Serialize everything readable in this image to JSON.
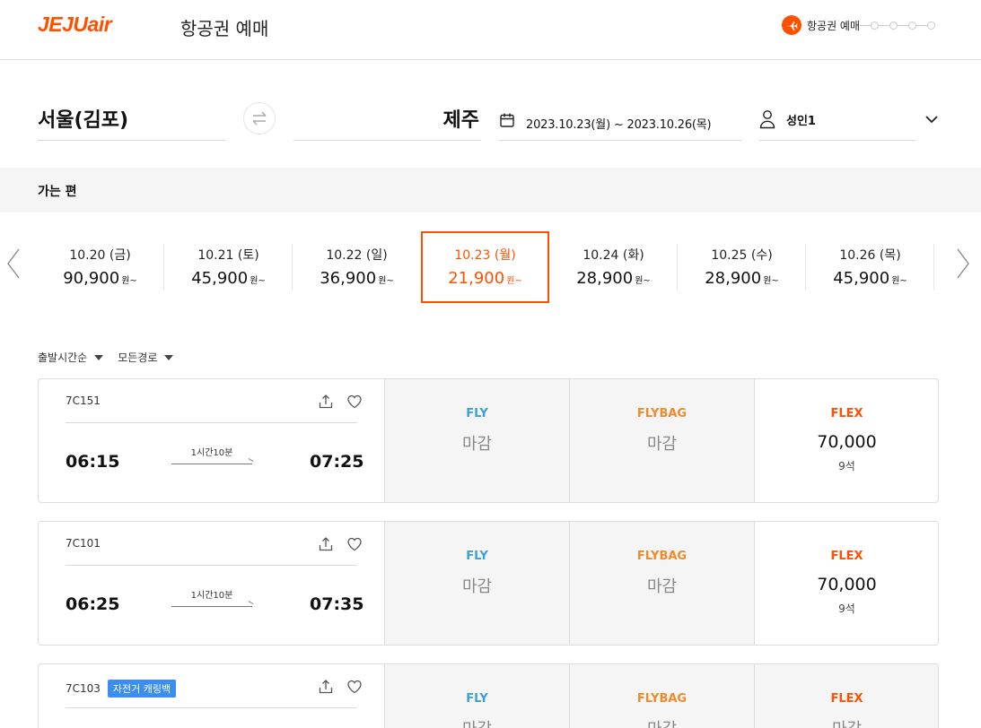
{
  "header": {
    "logo": "JEJUair",
    "title": "항공권 예매",
    "step_label": "항공권 예매"
  },
  "search": {
    "origin": "서울(김포)",
    "destination": "제주",
    "dates": "2023.10.23(월) ~ 2023.10.26(목)",
    "passengers": "성인1"
  },
  "section": {
    "label": "가는 편"
  },
  "date_strip": [
    {
      "date": "10.20 (금)",
      "price": "90,900",
      "unit": "원~",
      "selected": false
    },
    {
      "date": "10.21 (토)",
      "price": "45,900",
      "unit": "원~",
      "selected": false
    },
    {
      "date": "10.22 (일)",
      "price": "36,900",
      "unit": "원~",
      "selected": false
    },
    {
      "date": "10.23 (월)",
      "price": "21,900",
      "unit": "원~",
      "selected": true
    },
    {
      "date": "10.24 (화)",
      "price": "28,900",
      "unit": "원~",
      "selected": false
    },
    {
      "date": "10.25 (수)",
      "price": "28,900",
      "unit": "원~",
      "selected": false
    },
    {
      "date": "10.26 (목)",
      "price": "45,900",
      "unit": "원~",
      "selected": false
    }
  ],
  "sort": {
    "time": "출발시간순",
    "route": "모든경로"
  },
  "colors": {
    "brand": "#ff5000",
    "fly": "#3b9fd8",
    "flybag": "#f08a2b",
    "tag": "#3b8ef0"
  },
  "flights": [
    {
      "number": "7C151",
      "tag": "",
      "depart": "06:15",
      "arrive": "07:25",
      "duration": "1시간10분",
      "fares": [
        {
          "name": "FLY",
          "status": "마감"
        },
        {
          "name": "FLYBAG",
          "status": "마감"
        },
        {
          "name": "FLEX",
          "price": "70,000",
          "seats": "9석"
        }
      ]
    },
    {
      "number": "7C101",
      "tag": "",
      "depart": "06:25",
      "arrive": "07:35",
      "duration": "1시간10분",
      "fares": [
        {
          "name": "FLY",
          "status": "마감"
        },
        {
          "name": "FLYBAG",
          "status": "마감"
        },
        {
          "name": "FLEX",
          "price": "70,000",
          "seats": "9석"
        }
      ]
    },
    {
      "number": "7C103",
      "tag": "자전거 캐링백",
      "fares": [
        {
          "name": "FLY",
          "status": "마감"
        },
        {
          "name": "FLYBAG",
          "status": "마감"
        },
        {
          "name": "FLEX",
          "status": "마감"
        }
      ]
    }
  ]
}
